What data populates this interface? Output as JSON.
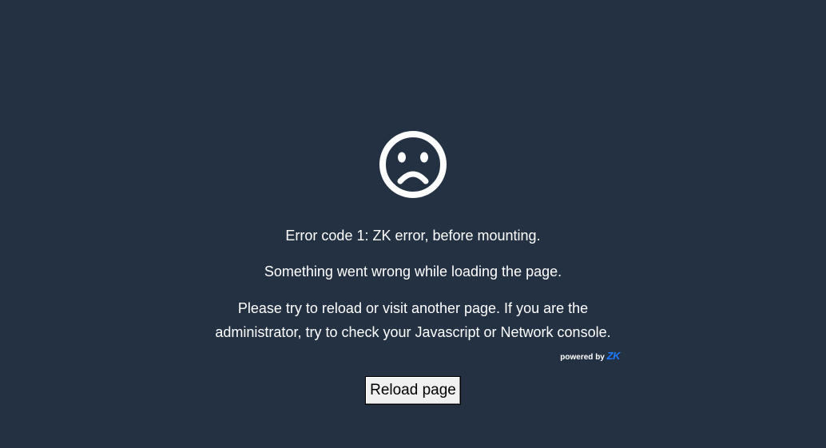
{
  "error": {
    "icon": "sad-face-icon",
    "code_line": "Error code 1: ZK error, before mounting.",
    "summary": "Something went wrong while loading the page.",
    "instructions": "Please try to reload or visit another page. If you are the administrator, try to check your Javascript or Network console."
  },
  "branding": {
    "powered_by": "powered by",
    "logo_text": "ZK",
    "logo_color": "#1e7bff"
  },
  "actions": {
    "reload_label": "Reload page"
  },
  "colors": {
    "background": "#243142",
    "text": "#ffffff"
  }
}
